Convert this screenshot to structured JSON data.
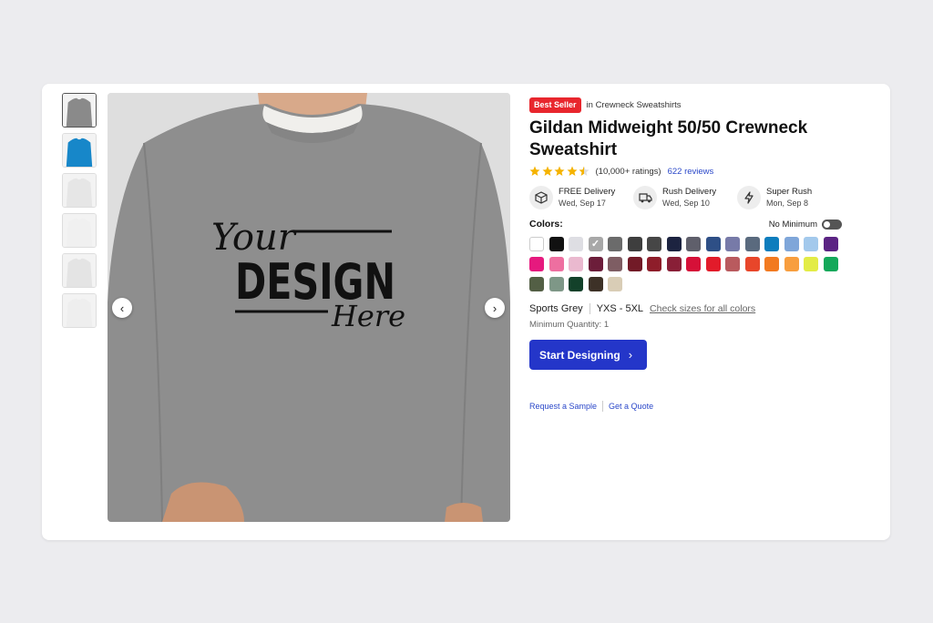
{
  "thumbnails": [
    {
      "name": "thumb-grey-front",
      "color": "#8a8a8a"
    },
    {
      "name": "thumb-blue",
      "color": "#1787c9"
    },
    {
      "name": "thumb-light-model",
      "color": "#e6e6e6"
    },
    {
      "name": "thumb-white-model",
      "color": "#f0f0f0"
    },
    {
      "name": "thumb-back",
      "color": "#e4e4e4"
    },
    {
      "name": "thumb-fabric",
      "color": "#eeeeee"
    }
  ],
  "hero": {
    "shirt_color": "#8e8e8e",
    "design_line1": "Your",
    "design_line2": "DESIGN",
    "design_line3": "Here",
    "prev_icon": "‹",
    "next_icon": "›"
  },
  "product": {
    "badge": "Best Seller",
    "category": "in Crewneck Sweatshirts",
    "title": "Gildan Midweight 50/50 Crewneck Sweatshirt",
    "rating": 4.5,
    "ratings_count": "(10,000+ ratings)",
    "reviews": "622 reviews"
  },
  "delivery": [
    {
      "icon": "box-icon",
      "title": "FREE Delivery",
      "date": "Wed, Sep 17"
    },
    {
      "icon": "truck-icon",
      "title": "Rush Delivery",
      "date": "Wed, Sep 10"
    },
    {
      "icon": "lightning-icon",
      "title": "Super Rush",
      "date": "Mon, Sep 8"
    }
  ],
  "colors": {
    "label": "Colors:",
    "no_minimum": "No Minimum",
    "swatches": [
      "#ffffff",
      "#111111",
      "#dedee3",
      "#a8a8a8",
      "#6b6b6b",
      "#3e3e3e",
      "#464646",
      "#1c2340",
      "#5f5f6b",
      "#2e4f86",
      "#777aa8",
      "#5a6a7e",
      "#0d7dbd",
      "#7fa6d9",
      "#a3c9ec",
      "#5b2483",
      "#e6197e",
      "#ee6fa0",
      "#eab9cf",
      "#6c1d3a",
      "#7e5d63",
      "#721a27",
      "#8e1d2a",
      "#891f37",
      "#d61038",
      "#e21b2a",
      "#b95a5e",
      "#e8462a",
      "#f27a20",
      "#f89e3e",
      "#e3ec46",
      "#14a85a",
      "#535f45",
      "#7e9787",
      "#13412a",
      "#3d3127",
      "#d9cdb6"
    ],
    "selected_index": 3
  },
  "selection": {
    "color_name": "Sports Grey",
    "sizes": "YXS - 5XL",
    "check_sizes": "Check sizes for all colors",
    "min_qty": "Minimum Quantity: 1"
  },
  "cta": {
    "label": "Start Designing",
    "chevron": "›"
  },
  "links": {
    "sample": "Request a Sample",
    "quote": "Get a Quote"
  }
}
